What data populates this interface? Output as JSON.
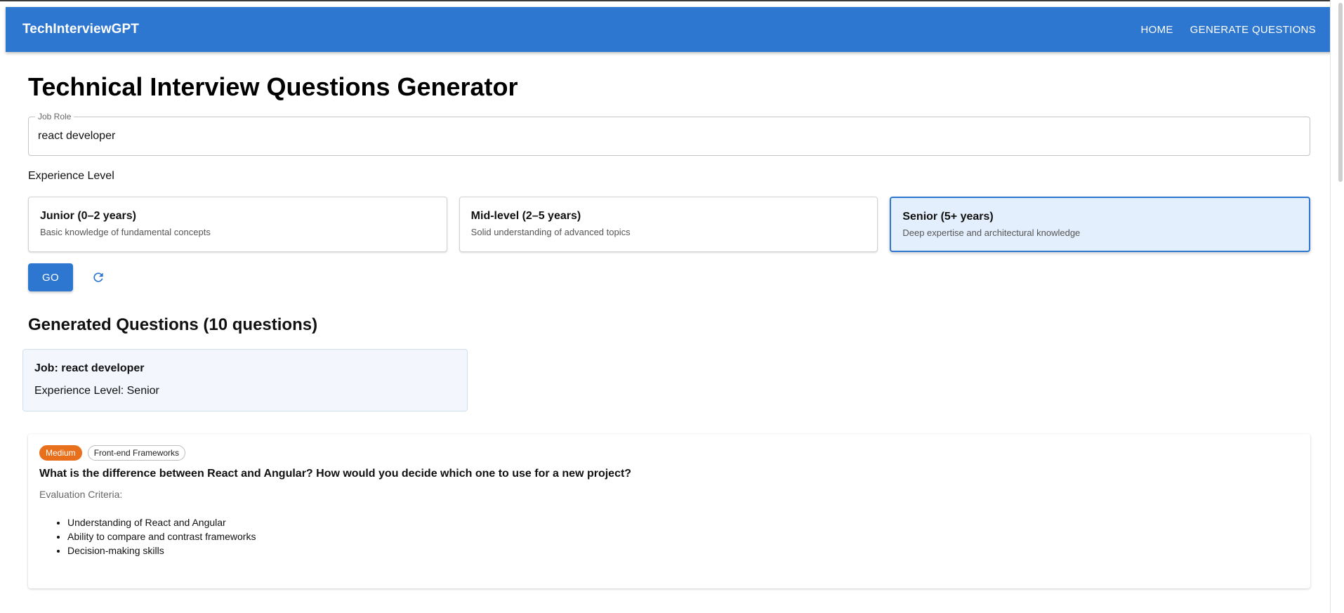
{
  "app": {
    "brand": "TechInterviewGPT",
    "nav": [
      "HOME",
      "GENERATE QUESTIONS"
    ],
    "accent_color": "#2e77d0"
  },
  "page": {
    "title": "Technical Interview Questions Generator"
  },
  "form": {
    "job_role_label": "Job Role",
    "job_role_value": "react developer",
    "experience_label": "Experience Level",
    "levels": [
      {
        "title": "Junior (0–2 years)",
        "description": "Basic knowledge of fundamental concepts",
        "selected": false
      },
      {
        "title": "Mid-level (2–5 years)",
        "description": "Solid understanding of advanced topics",
        "selected": false
      },
      {
        "title": "Senior (5+ years)",
        "description": "Deep expertise and architectural knowledge",
        "selected": true
      }
    ],
    "go_label": "GO",
    "refresh_icon": "refresh-icon"
  },
  "results": {
    "heading": "Generated Questions (10 questions)",
    "summary": {
      "job": "Job: react developer",
      "level": "Experience Level: Senior"
    },
    "questions": [
      {
        "difficulty": "Medium",
        "difficulty_color": "#e8701c",
        "topic": "Front-end Frameworks",
        "text": "What is the difference between React and Angular? How would you decide which one to use for a new project?",
        "evaluation_label": "Evaluation Criteria:",
        "criteria": [
          "Understanding of React and Angular",
          "Ability to compare and contrast frameworks",
          "Decision-making skills"
        ]
      }
    ]
  }
}
